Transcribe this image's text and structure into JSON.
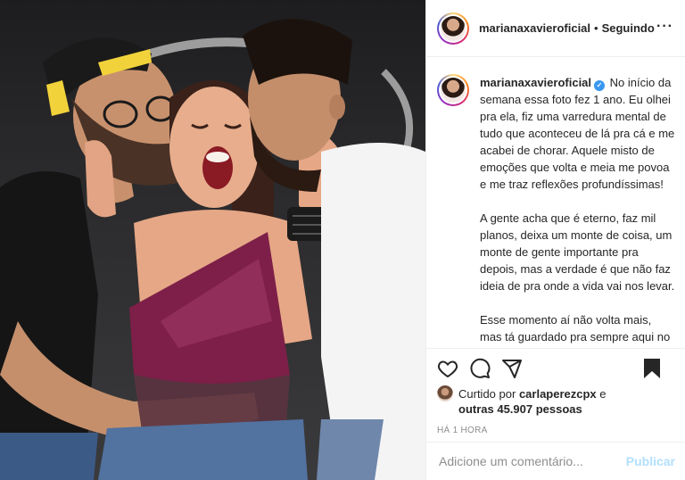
{
  "post": {
    "username": "marianaxavieroficial",
    "follow_separator": "•",
    "follow_status": "Seguindo",
    "more_label": "···"
  },
  "caption": {
    "username": "marianaxavieroficial",
    "verified_glyph": "✓",
    "text": "No início da semana essa foto fez 1 ano. Eu olhei pra ela, fiz uma varredura mental de tudo que aconteceu de lá pra cá e me acabei de chorar. Aquele misto de emoções que volta e meia me povoa e me traz reflexões profundíssimas!\n\nA gente acha que é eterno, faz mil planos, deixa um monte de coisa, um monte de gente importante pra depois, mas a verdade é que não faz ideia de pra onde a vida vai nos levar.\n\nEsse momento aí não volta mais, mas tá guardado pra sempre aqui no meu ❤. Foi vivido com todo o amor e toda a intensidade que merecia. E se"
  },
  "likes": {
    "prefix": "Curtido por",
    "user": "carlaperezcpx",
    "conjunction": "e",
    "others": "outras 45.907 pessoas"
  },
  "time_ago": "HÁ 1 HORA",
  "comment": {
    "placeholder": "Adicione um comentário...",
    "publish_label": "Publicar"
  },
  "icons": {
    "like": "heart-icon",
    "comment": "comment-icon",
    "share": "send-icon",
    "save": "bookmark-icon"
  },
  "colors": {
    "verified": "#3897f0",
    "publish_disabled": "#b2dffc",
    "muted": "#8e8e8e"
  }
}
